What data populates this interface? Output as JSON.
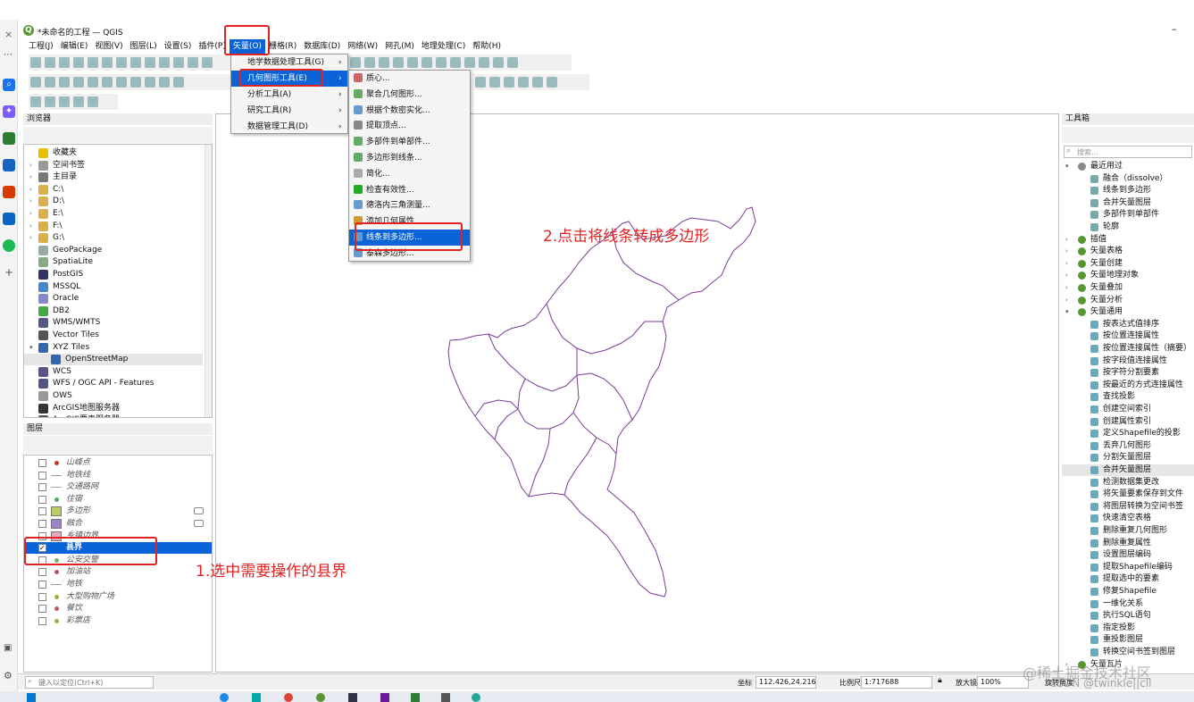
{
  "window": {
    "title": "*未命名的工程 — QGIS",
    "minimize": "–"
  },
  "menubar": [
    "工程(J)",
    "编辑(E)",
    "视图(V)",
    "图层(L)",
    "设置(S)",
    "插件(P)",
    "矢量(O)",
    "栅格(R)",
    "数据库(D)",
    "网络(W)",
    "网孔(M)",
    "地理处理(C)",
    "帮助(H)"
  ],
  "vector_menu": [
    {
      "label": "地学数据处理工具(G)",
      "arrow": "›"
    },
    {
      "label": "几何图形工具(E)",
      "arrow": "›"
    },
    {
      "label": "分析工具(A)",
      "arrow": "›"
    },
    {
      "label": "研究工具(R)",
      "arrow": "›"
    },
    {
      "label": "数据管理工具(D)",
      "arrow": "›"
    }
  ],
  "geometry_submenu": [
    "质心...",
    "聚合几何图形...",
    "根据个数密实化...",
    "提取顶点...",
    "多部件到单部件...",
    "多边形到线条...",
    "简化...",
    "检查有效性...",
    "德洛内三角测量...",
    "添加几何属性",
    "线条到多边形...",
    "泰森多边形..."
  ],
  "browser": {
    "title": "浏览器",
    "items": [
      "收藏夹",
      "空间书签",
      "主目录",
      "C:\\",
      "D:\\",
      "E:\\",
      "F:\\",
      "G:\\",
      "GeoPackage",
      "SpatiaLite",
      "PostGIS",
      "MSSQL",
      "Oracle",
      "DB2",
      "WMS/WMTS",
      "Vector Tiles",
      "XYZ Tiles",
      "OpenStreetMap",
      "WCS",
      "WFS / OGC API - Features",
      "OWS",
      "ArcGIS地图服务器",
      "ArcGIS要素服务器"
    ]
  },
  "layers": {
    "title": "图层",
    "items": [
      {
        "name": "山峰点",
        "checked": false
      },
      {
        "name": "地铁线",
        "checked": false
      },
      {
        "name": "交通路网",
        "checked": false
      },
      {
        "name": "住宿",
        "checked": false
      },
      {
        "name": "多边形",
        "checked": false
      },
      {
        "name": "融合",
        "checked": false
      },
      {
        "name": "乡镇边界",
        "checked": false
      },
      {
        "name": "县界",
        "checked": true
      },
      {
        "name": "公安交警",
        "checked": false
      },
      {
        "name": "加油站",
        "checked": false
      },
      {
        "name": "地铁",
        "checked": false
      },
      {
        "name": "大型购物广场",
        "checked": false
      },
      {
        "name": "餐饮",
        "checked": false
      },
      {
        "name": "彩票店",
        "checked": false
      }
    ]
  },
  "toolbox": {
    "title": "工具箱",
    "search_placeholder": "搜索...",
    "recent_title": "最近用过",
    "recent": [
      "融合（dissolve）",
      "线条到多边形",
      "合并矢量图层",
      "多部件到单部件",
      "轮廓"
    ],
    "groups": [
      "插值",
      "矢量表格",
      "矢量创建",
      "矢量地理对象",
      "矢量叠加",
      "矢量分析",
      "矢量通用"
    ],
    "general": [
      "按表达式值排序",
      "按位置连接属性",
      "按位置连接属性（摘要）",
      "按字段值连接属性",
      "按字符分割要素",
      "按最近的方式连接属性",
      "查找投影",
      "创建空间索引",
      "创建属性索引",
      "定义Shapefile的投影",
      "丢弃几何图形",
      "分割矢量图层",
      "合并矢量图层",
      "检测数据集更改",
      "将矢量要素保存到文件",
      "将图层转换为空间书签",
      "快速清空表格",
      "删除重复几何图形",
      "删除重复属性",
      "设置图层编码",
      "提取Shapefile编码",
      "提取选中的要素",
      "修复Shapefile",
      "一维化关系",
      "执行SQL语句",
      "指定投影",
      "重投影图层",
      "转换空间书签到图层"
    ],
    "last_group": "矢量瓦片"
  },
  "annotations": {
    "step1": "1.选中需要操作的县界",
    "step2": "2.点击将线条转成多边形"
  },
  "status": {
    "locate_placeholder": "键入以定位(Ctrl+K)",
    "coord_label": "坐标",
    "coord": "112.426,24.216",
    "scale_label": "比例尺",
    "scale": "1:717688",
    "magnifier_label": "放大镜",
    "magnifier": "100%",
    "rotation_label": "旋转角度"
  },
  "watermark": "@稀土掘金技术社区",
  "watermark2": "CSDN @twinkle||cll"
}
